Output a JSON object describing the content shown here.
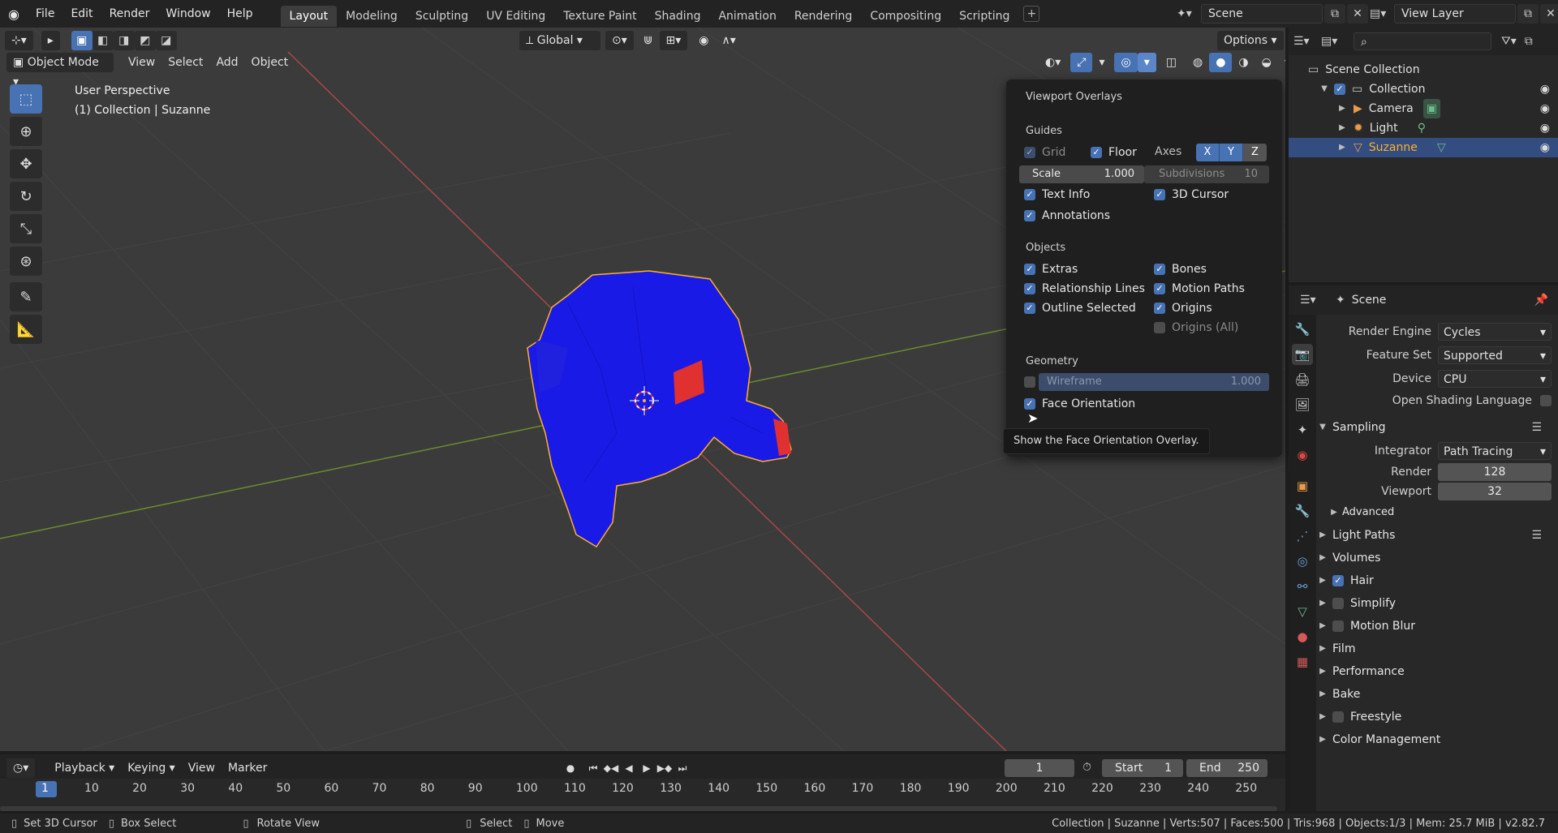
{
  "menu": [
    "File",
    "Edit",
    "Render",
    "Window",
    "Help"
  ],
  "workspaces": [
    "Layout",
    "Modeling",
    "Sculpting",
    "UV Editing",
    "Texture Paint",
    "Shading",
    "Animation",
    "Rendering",
    "Compositing",
    "Scripting"
  ],
  "active_workspace": "Layout",
  "scene_name": "Scene",
  "view_layer": "View Layer",
  "viewport": {
    "mode": "Object Mode",
    "menus": [
      "View",
      "Select",
      "Add",
      "Object"
    ],
    "transform_orientation": "Global",
    "options_label": "Options",
    "info_line1": "User Perspective",
    "info_line2": "(1) Collection | Suzanne"
  },
  "overlays": {
    "title": "Viewport Overlays",
    "guides_label": "Guides",
    "grid_label": "Grid",
    "floor_label": "Floor",
    "axes_label": "Axes",
    "axes": [
      "X",
      "Y",
      "Z"
    ],
    "scale_label": "Scale",
    "scale_value": "1.000",
    "subdiv_label": "Subdivisions",
    "subdiv_value": "10",
    "text_info": "Text Info",
    "cursor_3d": "3D Cursor",
    "annotations": "Annotations",
    "objects_label": "Objects",
    "extras": "Extras",
    "bones": "Bones",
    "relationship_lines": "Relationship Lines",
    "motion_paths": "Motion Paths",
    "outline_selected": "Outline Selected",
    "origins": "Origins",
    "origins_all": "Origins (All)",
    "geometry_label": "Geometry",
    "wireframe_label": "Wireframe",
    "wireframe_value": "1.000",
    "face_orientation": "Face Orientation",
    "tooltip": "Show the Face Orientation Overlay."
  },
  "outliner": {
    "root": "Scene Collection",
    "collection": "Collection",
    "items": [
      "Camera",
      "Light",
      "Suzanne"
    ]
  },
  "properties": {
    "context": "Scene",
    "render_engine_label": "Render Engine",
    "render_engine": "Cycles",
    "feature_set_label": "Feature Set",
    "feature_set": "Supported",
    "device_label": "Device",
    "device": "CPU",
    "osl_label": "Open Shading Language",
    "sampling_label": "Sampling",
    "integrator_label": "Integrator",
    "integrator": "Path Tracing",
    "render_label": "Render",
    "render_samples": "128",
    "viewport_label": "Viewport",
    "viewport_samples": "32",
    "advanced_label": "Advanced",
    "panels": [
      "Light Paths",
      "Volumes",
      "Hair",
      "Simplify",
      "Motion Blur",
      "Film",
      "Performance",
      "Bake",
      "Freestyle",
      "Color Management"
    ]
  },
  "timeline": {
    "menus": [
      "Playback",
      "Keying",
      "View",
      "Marker"
    ],
    "current_frame": "1",
    "start_label": "Start",
    "start": "1",
    "end_label": "End",
    "end": "250",
    "ticks": [
      "1",
      "10",
      "20",
      "30",
      "40",
      "50",
      "60",
      "70",
      "80",
      "90",
      "100",
      "110",
      "120",
      "130",
      "140",
      "150",
      "160",
      "170",
      "180",
      "190",
      "200",
      "210",
      "220",
      "230",
      "240",
      "250"
    ]
  },
  "status": {
    "left1": "Set 3D Cursor",
    "left2": "Box Select",
    "left3": "Rotate View",
    "left4": "Select",
    "left5": "Move",
    "right": "Collection | Suzanne | Verts:507 | Faces:500 | Tris:968 | Objects:1/3 | Mem: 25.7 MiB | v2.82.7"
  },
  "colors": {
    "accent": "#4772b3",
    "selected_object": "#ffaf29",
    "face_front": "#1a1ae6",
    "face_back": "#e03030"
  }
}
